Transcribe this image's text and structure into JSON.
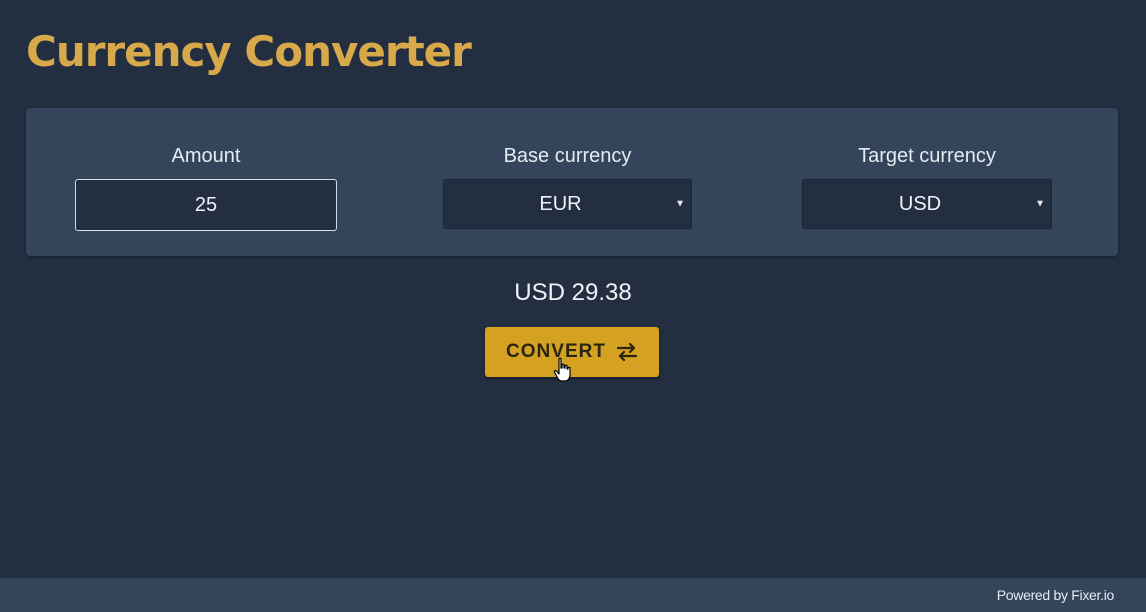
{
  "header": {
    "title": "Currency Converter"
  },
  "form": {
    "amount": {
      "label": "Amount",
      "value": "25"
    },
    "base_currency": {
      "label": "Base currency",
      "selected": "EUR"
    },
    "target_currency": {
      "label": "Target currency",
      "selected": "USD"
    }
  },
  "result": {
    "text": "USD 29.38"
  },
  "convert_button": {
    "label": "CONVERT",
    "icon": "swap-arrows-icon"
  },
  "footer": {
    "text": "Powered by Fixer.io"
  },
  "colors": {
    "background": "#232f40",
    "panel": "#33445b",
    "accent": "#d8a94a",
    "button": "#d4a220"
  }
}
